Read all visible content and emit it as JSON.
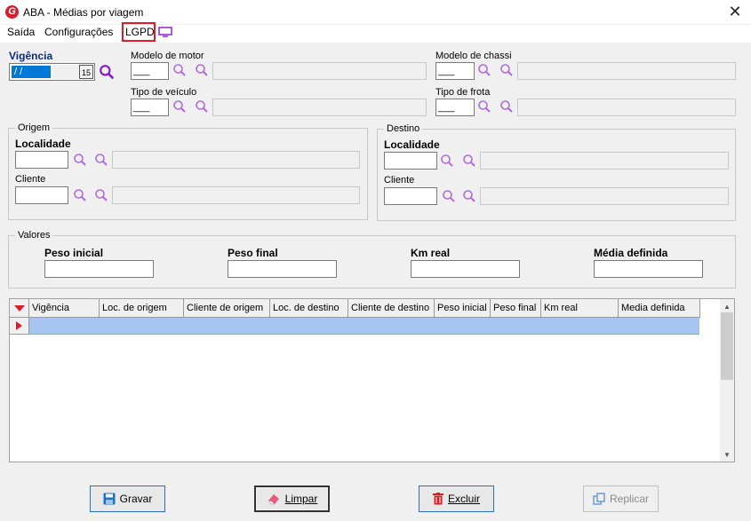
{
  "window": {
    "title": "ABA - Médias por viagem",
    "logo_letter": "G"
  },
  "menu": {
    "saida": "Saída",
    "configuracoes": "Configurações",
    "lgpd": "LGPD"
  },
  "vigencia": {
    "label": "Vigência",
    "value": " / /",
    "calendar_label": "15"
  },
  "fields": {
    "modelo_motor": {
      "label": "Modelo de motor",
      "code": "___"
    },
    "modelo_chassi": {
      "label": "Modelo de chassi",
      "code": "___"
    },
    "tipo_veiculo": {
      "label": "Tipo de veículo",
      "code": "___"
    },
    "tipo_frota": {
      "label": "Tipo de frota",
      "code": "___"
    }
  },
  "origem": {
    "title": "Origem",
    "localidade": "Localidade",
    "cliente": "Cliente"
  },
  "destino": {
    "title": "Destino",
    "localidade": "Localidade",
    "cliente": "Cliente"
  },
  "valores": {
    "title": "Valores",
    "peso_inicial": "Peso inicial",
    "peso_final": "Peso final",
    "km_real": "Km real",
    "media_definida": "Média definida"
  },
  "grid": {
    "columns": [
      "Vigência",
      "Loc. de origem",
      "Cliente de origem",
      "Loc. de destino",
      "Cliente de destino",
      "Peso inicial",
      "Peso final",
      "Km real",
      "Media definida"
    ]
  },
  "buttons": {
    "gravar": "Gravar",
    "limpar": "Limpar",
    "excluir": "Excluir",
    "replicar": "Replicar"
  },
  "colors": {
    "accent": "#0078d7",
    "lgpd_highlight": "#e21b23",
    "search_icon": "#b06be0",
    "brand": "#d4202a"
  }
}
